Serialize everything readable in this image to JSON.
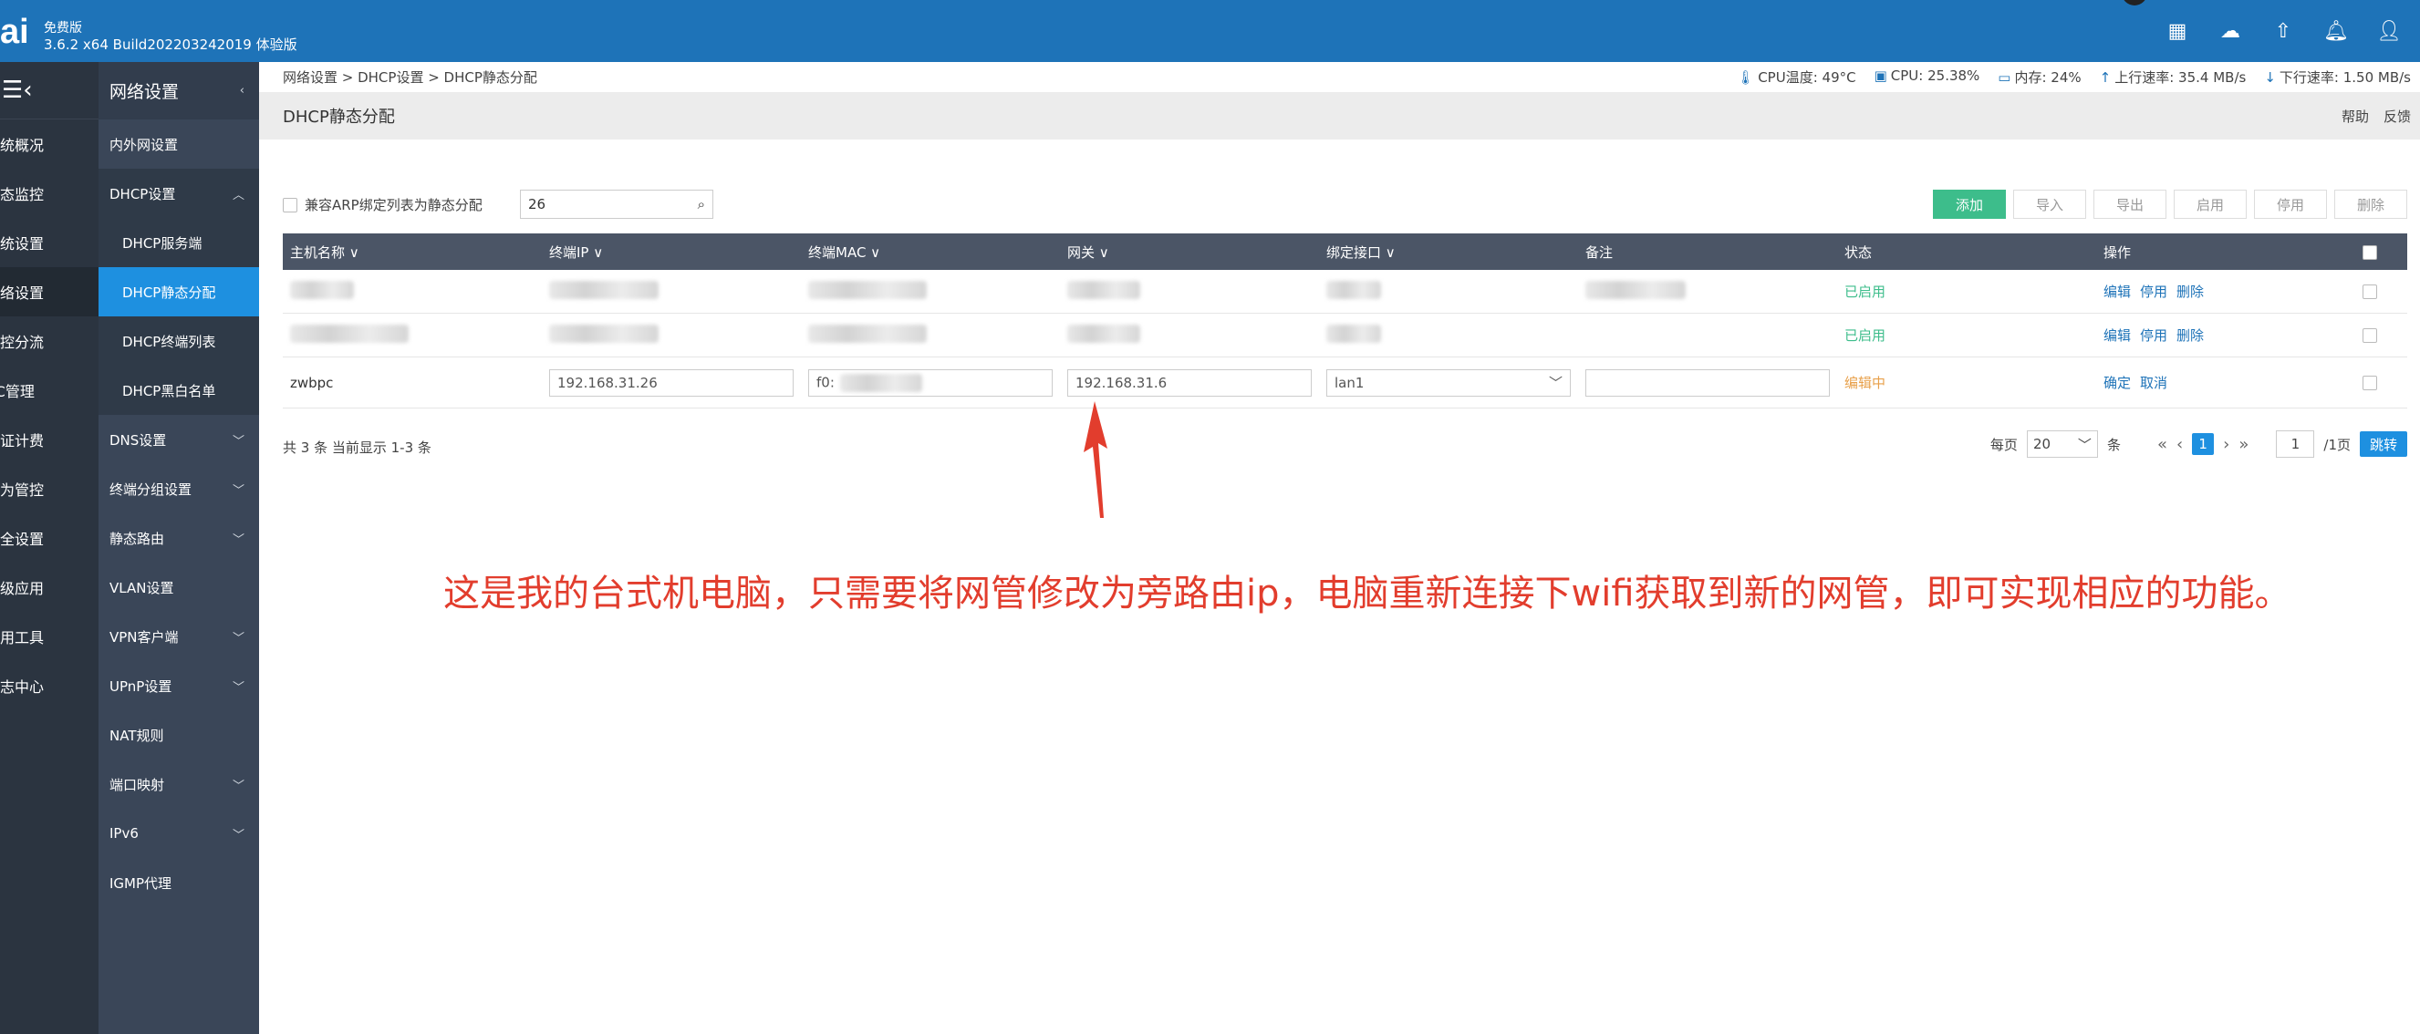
{
  "topbar": {
    "logo": "ai",
    "edition": "免费版",
    "build": "3.6.2 x64 Build202203242019 体验版",
    "icons": [
      "apps-icon",
      "cloud-icon",
      "upgrade-icon",
      "bell-icon",
      "user-icon"
    ]
  },
  "sidebar1": {
    "items": [
      "系统概况",
      "状态监控",
      "系统设置",
      "网络设置",
      "流控分流",
      "AC管理",
      "认证计费",
      "行为管控",
      "安全设置",
      "高级应用",
      "实用工具",
      "日志中心"
    ]
  },
  "sidebar2": {
    "title": "网络设置",
    "items": [
      {
        "label": "内外网设置"
      },
      {
        "label": "DHCP设置"
      },
      {
        "label": "DHCP服务端"
      },
      {
        "label": "DHCP静态分配"
      },
      {
        "label": "DHCP终端列表"
      },
      {
        "label": "DHCP黑白名单"
      },
      {
        "label": "DNS设置"
      },
      {
        "label": "终端分组设置"
      },
      {
        "label": "静态路由"
      },
      {
        "label": "VLAN设置"
      },
      {
        "label": "VPN客户端"
      },
      {
        "label": "UPnP设置"
      },
      {
        "label": "NAT规则"
      },
      {
        "label": "端口映射"
      },
      {
        "label": "IPv6"
      },
      {
        "label": "IGMP代理"
      }
    ]
  },
  "breadcrumb": "网络设置 > DHCP设置 > DHCP静态分配",
  "stats": {
    "cpu_temp": "CPU温度: 49°C",
    "cpu": "CPU: 25.38%",
    "mem": "内存: 24%",
    "up": "上行速率: 35.4 MB/s",
    "down": "下行速率: 1.50 MB/s"
  },
  "page": {
    "title": "DHCP静态分配",
    "help": "帮助",
    "feedback": "反馈"
  },
  "toolbar": {
    "compat_label": "兼容ARP绑定列表为静态分配",
    "search_value": "26",
    "buttons": [
      "添加",
      "导入",
      "导出",
      "启用",
      "停用",
      "删除"
    ]
  },
  "table": {
    "headers": [
      "主机名称 ∨",
      "终端IP ∨",
      "终端MAC ∨",
      "网关 ∨",
      "绑定接口 ∨",
      "备注",
      "状态",
      "操作"
    ],
    "rows": [
      {
        "status": "已启用",
        "ops": [
          "编辑",
          "停用",
          "删除"
        ]
      },
      {
        "status": "已启用",
        "ops": [
          "编辑",
          "停用",
          "删除"
        ]
      },
      {
        "host": "zwbpc",
        "ip": "192.168.31.26",
        "mac": "f0:",
        "gateway": "192.168.31.6",
        "iface": "lan1",
        "status": "编辑中",
        "ops": [
          "确定",
          "取消"
        ]
      }
    ]
  },
  "footer": {
    "summary": "共 3 条 当前显示 1-3 条",
    "per_page_label": "每页",
    "per_page": "20",
    "unit": "条",
    "current_page": "1",
    "page_input": "1",
    "total_pages": "/1页",
    "go": "跳转"
  },
  "annotation": "这是我的台式机电脑，只需要将网管修改为旁路由ip，电脑重新连接下wifi获取到新的网管，即可实现相应的功能。",
  "colors": {
    "topbar": "#1e73b8",
    "active_menu": "#1e90e0",
    "add_button": "#3dbd8b",
    "annotation": "#e23d2d"
  }
}
